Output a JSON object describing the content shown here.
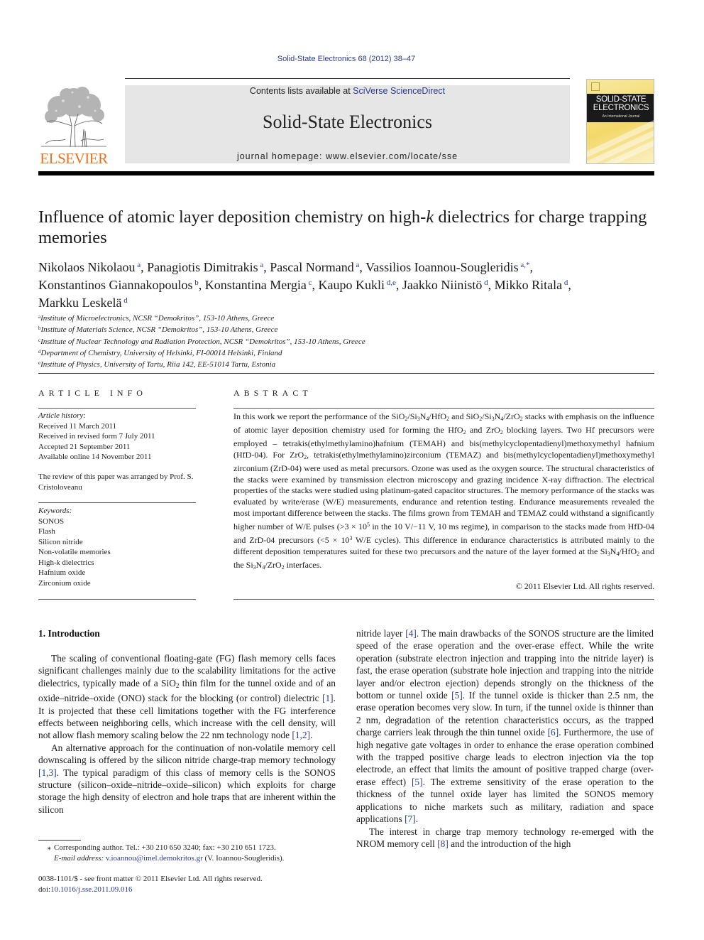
{
  "header": {
    "citation": "Solid-State Electronics 68 (2012) 38–47",
    "contents_prefix": "Contents lists available at ",
    "contents_link": "SciVerse ScienceDirect",
    "journal_name": "Solid-State Electronics",
    "homepage_prefix": "journal homepage: ",
    "homepage_url": "www.elsevier.com/locate/sse",
    "publisher_logo_text": "ELSEVIER",
    "cover": {
      "title_line1": "SOLID-STATE",
      "title_line2": "ELECTRONICS",
      "subtitle": "An International Journal"
    }
  },
  "article": {
    "title_part1": "Influence of atomic layer deposition chemistry on high-",
    "title_k": "k",
    "title_part2": " dielectrics for charge trapping memories",
    "authors": [
      {
        "name": "Nikolaos Nikolaou",
        "aff": "a",
        "sep": ", "
      },
      {
        "name": "Panagiotis Dimitrakis",
        "aff": "a",
        "sep": ", "
      },
      {
        "name": "Pascal Normand",
        "aff": "a",
        "sep": ", "
      },
      {
        "name": "Vassilios Ioannou-Sougleridis",
        "aff": "a,*",
        "sep": ", "
      },
      {
        "name": "Konstantinos Giannakopoulos",
        "aff": "b",
        "sep": ", "
      },
      {
        "name": "Konstantina Mergia",
        "aff": "c",
        "sep": ", "
      },
      {
        "name": "Kaupo Kukli",
        "aff": "d,e",
        "sep": ", "
      },
      {
        "name": "Jaakko Niinistö",
        "aff": "d",
        "sep": ", "
      },
      {
        "name": "Mikko Ritala",
        "aff": "d",
        "sep": ", "
      },
      {
        "name": "Markku Leskelä",
        "aff": "d",
        "sep": ""
      }
    ],
    "affiliations": [
      {
        "key": "a",
        "text": "Institute of Microelectronics, NCSR “Demokritos”, 153-10 Athens, Greece"
      },
      {
        "key": "b",
        "text": "Institute of Materials Science, NCSR “Demokritos”, 153-10 Athens, Greece"
      },
      {
        "key": "c",
        "text": "Institute of Nuclear Technology and Radiation Protection, NCSR “Demokritos”, 153-10 Athens, Greece"
      },
      {
        "key": "d",
        "text": "Department of Chemistry, University of Helsinki, FI-00014 Helsinki, Finland"
      },
      {
        "key": "e",
        "text": "Institute of Physics, University of Tartu, Riia 142, EE-51014 Tartu, Estonia"
      }
    ]
  },
  "article_info": {
    "heading": "ARTICLE INFO",
    "history_label": "Article history:",
    "history": [
      "Received 11 March 2011",
      "Received in revised form 7 July 2011",
      "Accepted 21 September 2011",
      "Available online 14 November 2011"
    ],
    "review_note": "The review of this paper was arranged by Prof. S. Cristoloveanu",
    "keywords_label": "Keywords:",
    "keywords": [
      "SONOS",
      "Flash",
      "Silicon nitride",
      "Non-volatile memories",
      "High-k dielectrics",
      "Hafnium oxide",
      "Zirconium oxide"
    ]
  },
  "abstract": {
    "heading": "ABSTRACT",
    "segments": [
      {
        "t": "In this work we report the performance of the SiO"
      },
      {
        "sub": "2"
      },
      {
        "t": "/Si"
      },
      {
        "sub": "3"
      },
      {
        "t": "N"
      },
      {
        "sub": "4"
      },
      {
        "t": "/HfO"
      },
      {
        "sub": "2"
      },
      {
        "t": " and SiO"
      },
      {
        "sub": "2"
      },
      {
        "t": "/Si"
      },
      {
        "sub": "3"
      },
      {
        "t": "N"
      },
      {
        "sub": "4"
      },
      {
        "t": "/ZrO"
      },
      {
        "sub": "2"
      },
      {
        "t": " stacks with emphasis on the influence of atomic layer deposition chemistry used for forming the HfO"
      },
      {
        "sub": "2"
      },
      {
        "t": " and ZrO"
      },
      {
        "sub": "2"
      },
      {
        "t": " blocking layers. Two Hf precursors were employed – tetrakis(ethylmethylamino)hafnium (TEMAH) and bis(methylcyclopentadienyl)methoxymethyl hafnium (HfD-04). For ZrO"
      },
      {
        "sub": "2"
      },
      {
        "t": ", tetrakis(ethylmethylamino)zirconium (TEMAZ) and bis(methylcyclopentadienyl)methoxymethyl zirconium (ZrD-04) were used as metal precursors. Ozone was used as the oxygen source. The structural characteristics of the stacks were examined by transmission electron microscopy and grazing incidence X-ray diffraction. The electrical properties of the stacks were studied using platinum-gated capacitor structures. The memory performance of the stacks was evaluated by write/erase (W/E) measurements, endurance and retention testing. Endurance measurements revealed the most important difference between the stacks. The films grown from TEMAH and TEMAZ could withstand a significantly higher number of W/E pulses (>3 × 10"
      },
      {
        "sup": "5"
      },
      {
        "t": " in the 10 V/−11 V, 10 ms regime), in comparison to the stacks made from HfD-04 and ZrD-04 precursors (<5 × 10"
      },
      {
        "sup": "3"
      },
      {
        "t": " W/E cycles). This difference in endurance characteristics is attributed mainly to the different deposition temperatures suited for these two precursors and the nature of the layer formed at the Si"
      },
      {
        "sub": "3"
      },
      {
        "t": "N"
      },
      {
        "sub": "4"
      },
      {
        "t": "/HfO"
      },
      {
        "sub": "2"
      },
      {
        "t": " and the Si"
      },
      {
        "sub": "3"
      },
      {
        "t": "N"
      },
      {
        "sub": "4"
      },
      {
        "t": "/ZrO"
      },
      {
        "sub": "2"
      },
      {
        "t": " interfaces."
      }
    ],
    "copyright": "© 2011 Elsevier Ltd. All rights reserved."
  },
  "introduction": {
    "heading": "1. Introduction",
    "left_paragraphs": [
      [
        {
          "t": "The scaling of conventional floating-gate (FG) flash memory cells faces significant challenges mainly due to the scalability limitations for the active dielectrics, typically made of a SiO"
        },
        {
          "sub": "2"
        },
        {
          "t": " thin film for the tunnel oxide and of an oxide–nitride–oxide (ONO) stack for the blocking (or control) dielectric "
        },
        {
          "ref": "[1]"
        },
        {
          "t": ". It is projected that these cell limitations together with the FG interference effects between neighboring cells, which increase with the cell density, will not allow flash memory scaling below the 22 nm technology node "
        },
        {
          "ref": "[1,2]"
        },
        {
          "t": "."
        }
      ],
      [
        {
          "t": "An alternative approach for the continuation of non-volatile memory cell downscaling is offered by the silicon nitride charge-trap memory technology "
        },
        {
          "ref": "[1,3]"
        },
        {
          "t": ". The typical paradigm of this class of memory cells is the SONOS structure (silicon–oxide–nitride–oxide–silicon) which exploits for charge storage the high density of electron and hole traps that are inherent within the silicon"
        }
      ]
    ],
    "right_paragraphs": [
      [
        {
          "t": "nitride layer "
        },
        {
          "ref": "[4]"
        },
        {
          "t": ". The main drawbacks of the SONOS structure are the limited speed of the erase operation and the over-erase effect. While the write operation (substrate electron injection and trapping into the nitride layer) is fast, the erase operation (substrate hole injection and trapping into the nitride layer and/or electron ejection) depends strongly on the thickness of the bottom or tunnel oxide "
        },
        {
          "ref": "[5]"
        },
        {
          "t": ". If the tunnel oxide is thicker than 2.5 nm, the erase operation becomes very slow. In turn, if the tunnel oxide is thinner than 2 nm, degradation of the retention characteristics occurs, as the trapped charge carriers leak through the thin tunnel oxide "
        },
        {
          "ref": "[6]"
        },
        {
          "t": ". Furthermore, the use of high negative gate voltages in order to enhance the erase operation combined with the trapped positive charge leads to electron injection via the top electrode, an effect that limits the amount of positive trapped charge (over-erase effect) "
        },
        {
          "ref": "[5]"
        },
        {
          "t": ". The extreme sensitivity of the erase operation to the thickness of the tunnel oxide layer has limited the SONOS memory applications to niche markets such as military, radiation and space applications "
        },
        {
          "ref": "[7]"
        },
        {
          "t": "."
        }
      ],
      [
        {
          "t": "The interest in charge trap memory technology re-emerged with the NROM memory cell "
        },
        {
          "ref": "[8]"
        },
        {
          "t": " and the introduction of the high"
        }
      ]
    ]
  },
  "footnote": {
    "star": "⁎",
    "corresponding": "Corresponding author. Tel.: +30 210 650 3240; fax: +30 210 651 1723.",
    "email_label": "E-mail address:",
    "email": "v.ioannou@imel.demokritos.gr",
    "email_suffix": " (V. Ioannou-Sougleridis)."
  },
  "front_matter": {
    "issn_line": "0038-1101/$ - see front matter © 2011 Elsevier Ltd. All rights reserved.",
    "doi_prefix": "doi:",
    "doi": "10.1016/j.sse.2011.09.016"
  },
  "colors": {
    "link": "#2b3a8c",
    "elsevier_orange": "#e8731e",
    "masthead_bg": "#e6e6e6"
  }
}
